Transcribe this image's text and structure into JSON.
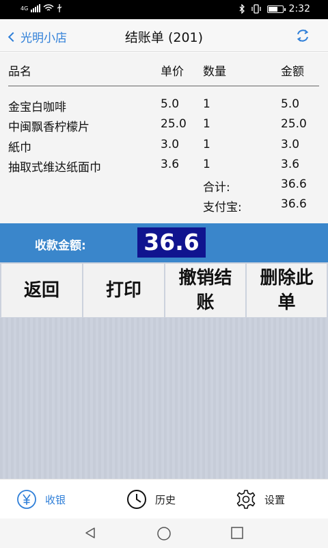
{
  "status_bar": {
    "network": "4G",
    "time": "2:32"
  },
  "nav": {
    "back_label": "光明小店",
    "title": "结账单 (201)"
  },
  "table": {
    "headers": {
      "name": "品名",
      "price": "单价",
      "qty": "数量",
      "amount": "金额"
    },
    "items": [
      {
        "name": "金宝白咖啡",
        "price": "5.0",
        "qty": "1",
        "amount": "5.0"
      },
      {
        "name": "中闽飘香柠檬片",
        "price": "25.0",
        "qty": "1",
        "amount": "25.0"
      },
      {
        "name": "紙巾",
        "price": "3.0",
        "qty": "1",
        "amount": "3.0"
      },
      {
        "name": "抽取式维达纸面巾",
        "price": "3.6",
        "qty": "1",
        "amount": "3.6"
      }
    ],
    "total_label": "合计:",
    "total_value": "36.6",
    "payment_label": "支付宝:",
    "payment_value": "36.6"
  },
  "collect": {
    "label": "收款金额:",
    "value": "36.6"
  },
  "actions": {
    "back": "返回",
    "print": "打印",
    "cancel_line1": "撤销结",
    "cancel_line2": "账",
    "delete_line1": "删除此",
    "delete_line2": "单"
  },
  "tabs": {
    "cashier": "收银",
    "history": "历史",
    "settings": "设置"
  },
  "colors": {
    "accent": "#2f7fd8",
    "collect_bar": "#3a86cb",
    "amount_highlight": "#10148f"
  }
}
